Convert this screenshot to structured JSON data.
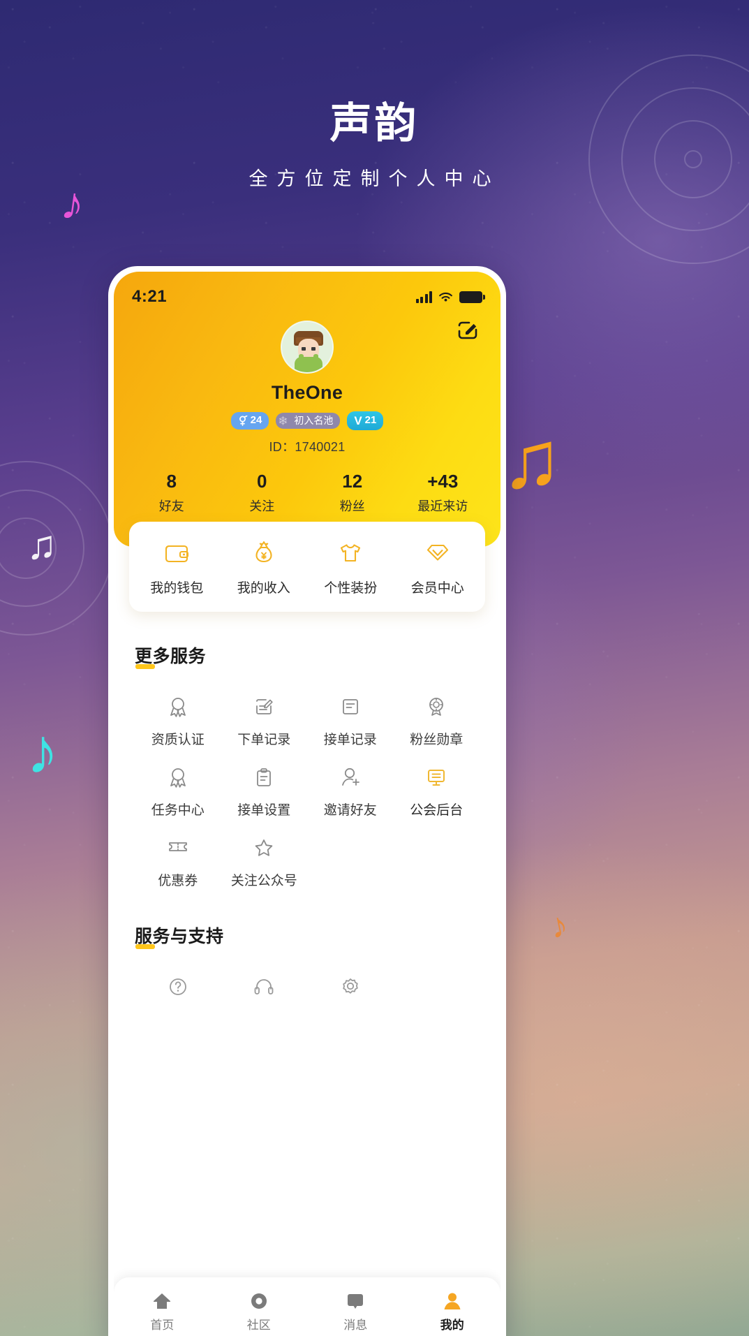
{
  "promo": {
    "title": "声韵",
    "subtitle": "全方位定制个人中心"
  },
  "phone": {
    "statusbar": {
      "time": "4:21",
      "signal_icon": "signal-bars-icon",
      "wifi_icon": "wifi-icon",
      "battery_icon": "battery-icon"
    },
    "header": {
      "edit_icon": "edit-profile-icon",
      "avatar": "user-avatar",
      "username": "TheOne",
      "badges": [
        {
          "name": "gender-badge",
          "icon": "male-gender-icon",
          "value": "24"
        },
        {
          "name": "title-badge",
          "icon": "clover-icon",
          "value": "初入名池"
        },
        {
          "name": "vip-badge",
          "letter": "V",
          "value": "21"
        }
      ],
      "user_id": "ID：1740021",
      "stats": [
        {
          "value": "8",
          "label": "好友"
        },
        {
          "value": "0",
          "label": "关注"
        },
        {
          "value": "12",
          "label": "粉丝"
        },
        {
          "value": "+43",
          "label": "最近来访"
        }
      ]
    },
    "quick_actions": [
      {
        "icon": "wallet-icon",
        "label": "我的钱包"
      },
      {
        "icon": "money-bag-icon",
        "label": "我的收入"
      },
      {
        "icon": "tshirt-icon",
        "label": "个性装扮"
      },
      {
        "icon": "diamond-icon",
        "label": "会员中心"
      }
    ],
    "more_services": {
      "title": "更多服务",
      "items": [
        {
          "icon": "medal-icon",
          "label": "资质认证",
          "accent": false
        },
        {
          "icon": "edit-document-icon",
          "label": "下单记录",
          "accent": false
        },
        {
          "icon": "document-lines-icon",
          "label": "接单记录",
          "accent": false
        },
        {
          "icon": "fan-medal-icon",
          "label": "粉丝勋章",
          "accent": false
        },
        {
          "icon": "medal-icon",
          "label": "任务中心",
          "accent": false
        },
        {
          "icon": "clipboard-icon",
          "label": "接单设置",
          "accent": false
        },
        {
          "icon": "add-person-icon",
          "label": "邀请好友",
          "accent": false
        },
        {
          "icon": "monitor-icon",
          "label": "公会后台",
          "accent": true
        },
        {
          "icon": "ticket-icon",
          "label": "优惠券",
          "accent": false
        },
        {
          "icon": "star-icon",
          "label": "关注公众号",
          "accent": false
        }
      ]
    },
    "support": {
      "title": "服务与支持",
      "items": [
        {
          "icon": "question-circle-icon",
          "label": ""
        },
        {
          "icon": "headset-icon",
          "label": ""
        },
        {
          "icon": "gear-icon",
          "label": ""
        }
      ]
    },
    "navbar": [
      {
        "icon": "home-icon",
        "label": "首页",
        "active": false
      },
      {
        "icon": "community-icon",
        "label": "社区",
        "active": false
      },
      {
        "icon": "message-icon",
        "label": "消息",
        "active": false
      },
      {
        "icon": "profile-icon",
        "label": "我的",
        "active": true
      }
    ]
  },
  "colors": {
    "accent_gold": "#ffc61a",
    "header_start": "#f5a70d",
    "header_end": "#fde41a",
    "vip_blue": "#2ec6e6",
    "gender_blue": "#66a5f0",
    "title_purple": "#8f88ab",
    "nav_active": "#f5a623"
  }
}
